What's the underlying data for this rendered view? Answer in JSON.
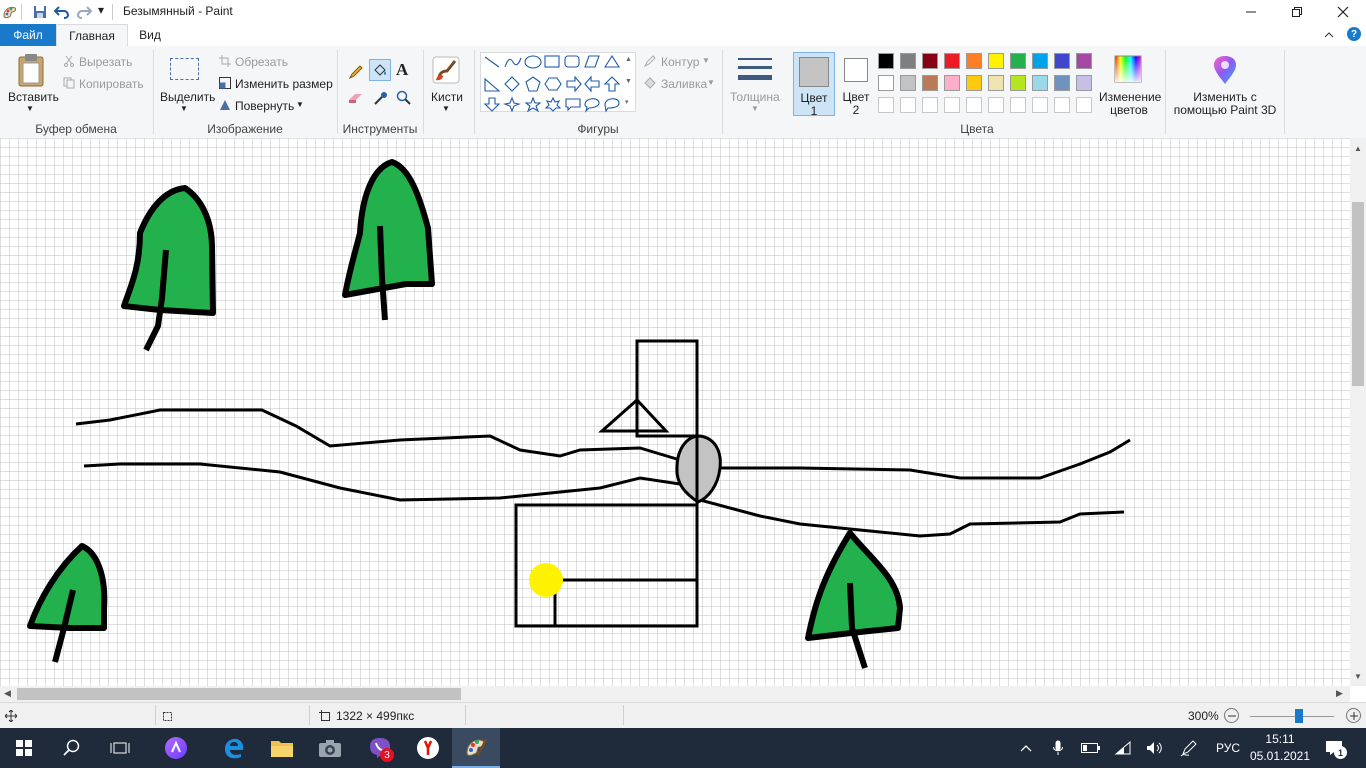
{
  "window": {
    "title": "Безымянный - Paint",
    "qat_dropdown": "▾"
  },
  "tabs": {
    "file": "Файл",
    "home": "Главная",
    "view": "Вид"
  },
  "ribbon": {
    "clipboard": {
      "paste": "Вставить",
      "cut": "Вырезать",
      "copy": "Копировать",
      "group": "Буфер обмена"
    },
    "image": {
      "select": "Выделить",
      "crop": "Обрезать",
      "resize": "Изменить размер",
      "rotate": "Повернуть",
      "group": "Изображение"
    },
    "tools": {
      "group": "Инструменты",
      "text_glyph": "A"
    },
    "brushes": {
      "label": "Кисти"
    },
    "shapes": {
      "outline": "Контур",
      "fill": "Заливка",
      "group": "Фигуры"
    },
    "size": {
      "label": "Толщина"
    },
    "color1": {
      "line1": "Цвет",
      "line2": "1"
    },
    "color2": {
      "line1": "Цвет",
      "line2": "2"
    },
    "colors_group": "Цвета",
    "edit_colors": {
      "line1": "Изменение",
      "line2": "цветов"
    },
    "paint3d": {
      "line1": "Изменить с",
      "line2": "помощью Paint 3D"
    }
  },
  "palette_row1": [
    "#000000",
    "#7f7f7f",
    "#880015",
    "#ed1c24",
    "#ff7f27",
    "#fff200",
    "#22b14c",
    "#00a2e8",
    "#3f48cc",
    "#a349a4"
  ],
  "palette_row2": [
    "#ffffff",
    "#c3c3c3",
    "#b97a57",
    "#ffaec9",
    "#ffc90e",
    "#efe4b0",
    "#b5e61d",
    "#99d9ea",
    "#7092be",
    "#c8bfe7"
  ],
  "colors": {
    "color1": "#c3c3c3",
    "color2": "#ffffff",
    "accent": "#1979ca",
    "tree_green": "#22b14c",
    "sun_yellow": "#fff200",
    "grid": "#c0c0c0"
  },
  "status": {
    "dimensions": "1322 × 499пкс",
    "zoom": "300%",
    "zoom_level": 0.58
  },
  "taskbar": {
    "lang": "РУС",
    "time": "15:11",
    "date": "05.01.2021",
    "viber_badge": "3",
    "notif_count": "1"
  }
}
